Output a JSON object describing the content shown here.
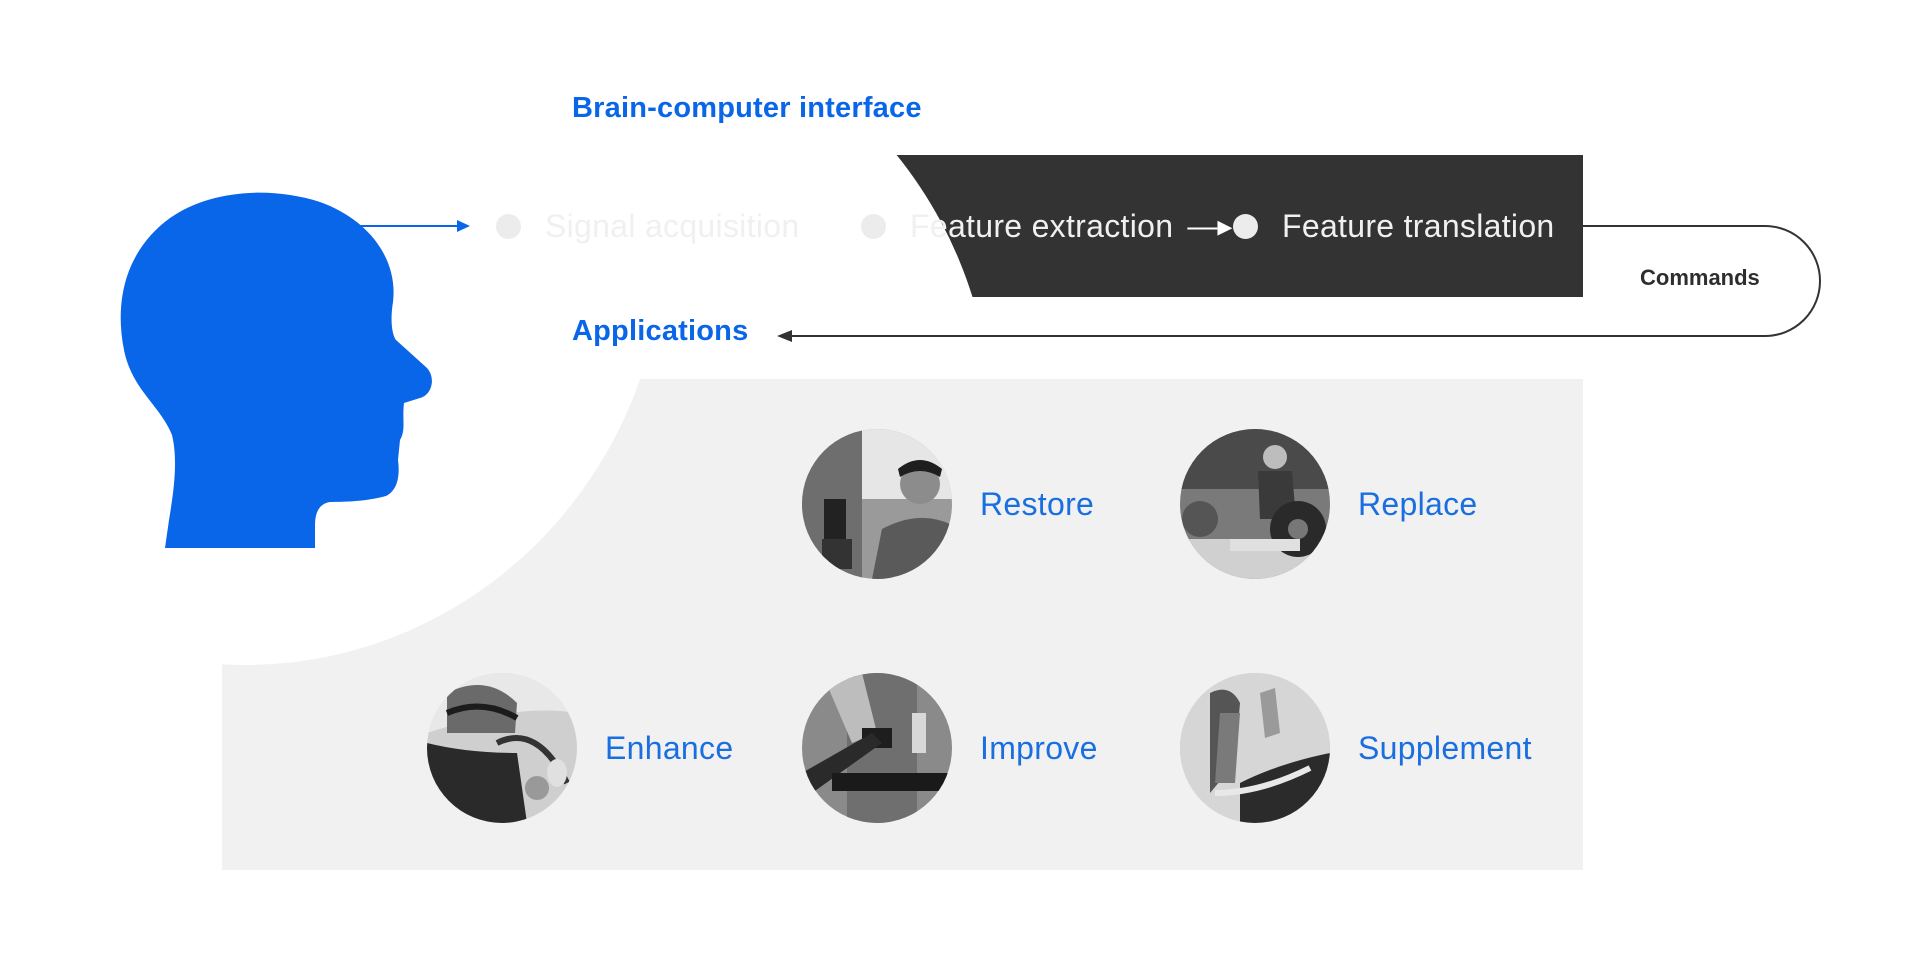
{
  "diagram": {
    "accent_color": "#0a66e8",
    "bar_color": "#333333",
    "panel_color": "#f1f1f1"
  },
  "header": {
    "title": "Brain-computer interface"
  },
  "pipeline": {
    "stages": [
      {
        "label": "Signal acquisition"
      },
      {
        "label": "Feature extraction"
      },
      {
        "label": "Feature translation"
      }
    ],
    "arrow_glyph": "—▸"
  },
  "feedback": {
    "commands_label": "Commands"
  },
  "applications": {
    "title": "Applications",
    "items": [
      {
        "label": "Restore",
        "photo": "person-with-eeg-cap-and-hand-orthosis"
      },
      {
        "label": "Replace",
        "photo": "wheelchair-rugby-player"
      },
      {
        "label": "Enhance",
        "photo": "driver-with-eeg-headset"
      },
      {
        "label": "Improve",
        "photo": "arm-with-rehabilitation-device"
      },
      {
        "label": "Supplement",
        "photo": "robotic-arm-prosthesis"
      }
    ]
  }
}
